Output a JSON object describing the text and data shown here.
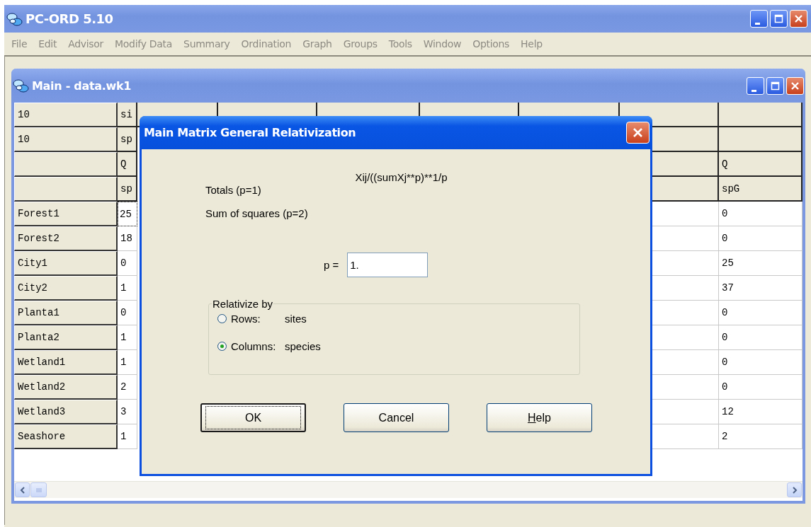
{
  "window": {
    "title": "PC-ORD 5.10"
  },
  "menu": [
    {
      "label": "File",
      "disabled": true
    },
    {
      "label": "Edit",
      "disabled": true
    },
    {
      "label": "Advisor",
      "disabled": true
    },
    {
      "label": "Modify Data",
      "disabled": true
    },
    {
      "label": "Summary",
      "disabled": true
    },
    {
      "label": "Ordination",
      "disabled": true
    },
    {
      "label": "Graph",
      "disabled": true
    },
    {
      "label": "Groups",
      "disabled": true
    },
    {
      "label": "Tools",
      "disabled": true
    },
    {
      "label": "Window",
      "disabled": true
    },
    {
      "label": "Options",
      "disabled": true
    },
    {
      "label": "Help",
      "disabled": true
    }
  ],
  "main_window": {
    "title": "Main - data.wk1",
    "header_rows": [
      {
        "row_label": "10",
        "column_1": "si"
      },
      {
        "row_label": "10",
        "column_1": "sp"
      },
      {
        "column_1": "Q",
        "column_8": "Q"
      },
      {
        "column_1": "sp",
        "column_8": "spG"
      }
    ],
    "rows": [
      {
        "row_label": "Forest1",
        "column_1": "25",
        "column_1_focused": true,
        "column_8": "0"
      },
      {
        "row_label": "Forest2",
        "column_1": "18",
        "column_1_focused": false,
        "column_8": "0"
      },
      {
        "row_label": "City1",
        "column_1": "0",
        "column_1_focused": false,
        "column_8": "25"
      },
      {
        "row_label": "City2",
        "column_1": "1",
        "column_1_focused": false,
        "column_8": "37"
      },
      {
        "row_label": "Planta1",
        "column_1": "0",
        "column_1_focused": false,
        "column_8": "0"
      },
      {
        "row_label": "Planta2",
        "column_1": "1",
        "column_1_focused": false,
        "column_8": "0"
      },
      {
        "row_label": "Wetland1",
        "column_1": "1",
        "column_1_focused": false,
        "column_8": "0"
      },
      {
        "row_label": "Wetland2",
        "column_1": "2",
        "column_1_focused": false,
        "column_8": "0"
      },
      {
        "row_label": "Wetland3",
        "column_1": "3",
        "column_1_focused": false,
        "column_8": "12"
      },
      {
        "row_label": "Seashore",
        "column_1": "1",
        "column_1_focused": false,
        "column_8": "2"
      }
    ]
  },
  "dialog": {
    "title": "Main Matrix General Relativization",
    "formula": "Xij/((sumXj**p)**1/p",
    "notes": [
      "Totals (p=1)",
      "Sum of squares (p=2)"
    ],
    "p_field": {
      "label": "p =",
      "value": "1."
    },
    "group": {
      "title": "Relativize by",
      "options": [
        {
          "label": "Rows:",
          "value": "sites",
          "selected": false
        },
        {
          "label": "Columns:",
          "value": "species",
          "selected": true
        }
      ]
    },
    "buttons": [
      {
        "label": "OK",
        "default": true,
        "underline_first": false
      },
      {
        "label": "Cancel",
        "default": false,
        "underline_first": false
      },
      {
        "label": "Help",
        "default": false,
        "underline_first": true
      }
    ]
  }
}
